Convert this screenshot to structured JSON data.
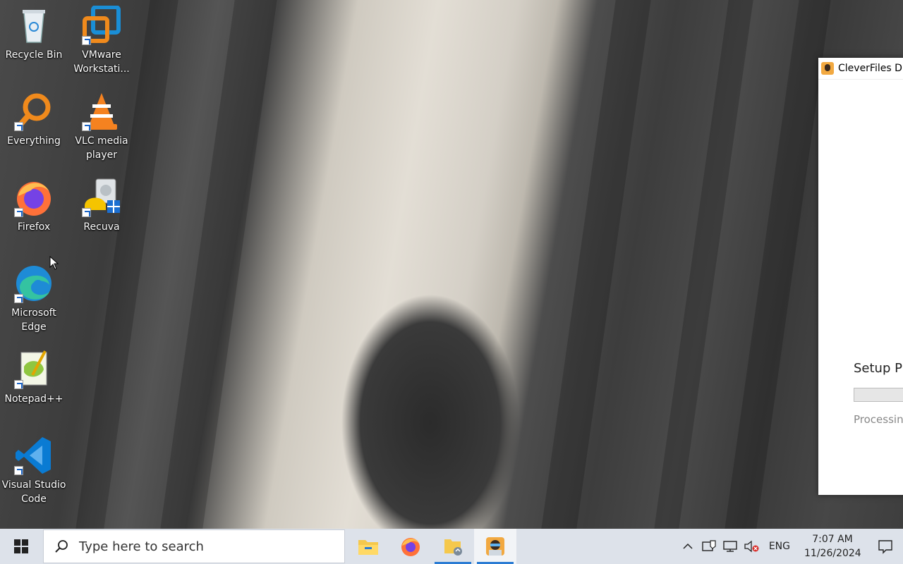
{
  "desktop": {
    "icons": [
      {
        "label": "Recycle Bin",
        "icon": "recycle-bin-icon"
      },
      {
        "label": "VMware Workstati...",
        "icon": "vmware-icon"
      },
      {
        "label": "Everything",
        "icon": "everything-search-icon"
      },
      {
        "label": "VLC media player",
        "icon": "vlc-icon"
      },
      {
        "label": "Firefox",
        "icon": "firefox-icon"
      },
      {
        "label": "Recuva",
        "icon": "recuva-icon"
      },
      {
        "label": "Microsoft Edge",
        "icon": "edge-icon"
      },
      {
        "label": "Notepad++",
        "icon": "notepad-plus-plus-icon"
      },
      {
        "label": "Visual Studio Code",
        "icon": "vscode-icon"
      }
    ]
  },
  "setup_window": {
    "title": "CleverFiles Dis",
    "heading": "Setup Pr",
    "status": "Processin",
    "progress": 0
  },
  "taskbar": {
    "search_placeholder": "Type here to search",
    "apps": [
      {
        "name": "File Explorer",
        "icon": "file-explorer-icon"
      },
      {
        "name": "Firefox",
        "icon": "firefox-icon"
      },
      {
        "name": "File Explorer window",
        "icon": "folder-icon"
      },
      {
        "name": "CleverFiles Disk Drill setup",
        "icon": "disk-drill-icon"
      }
    ],
    "language": "ENG",
    "time": "7:07 AM",
    "date": "11/26/2024"
  },
  "colors": {
    "taskbar_bg": "#dde2ea",
    "accent": "#2a7bd3"
  }
}
